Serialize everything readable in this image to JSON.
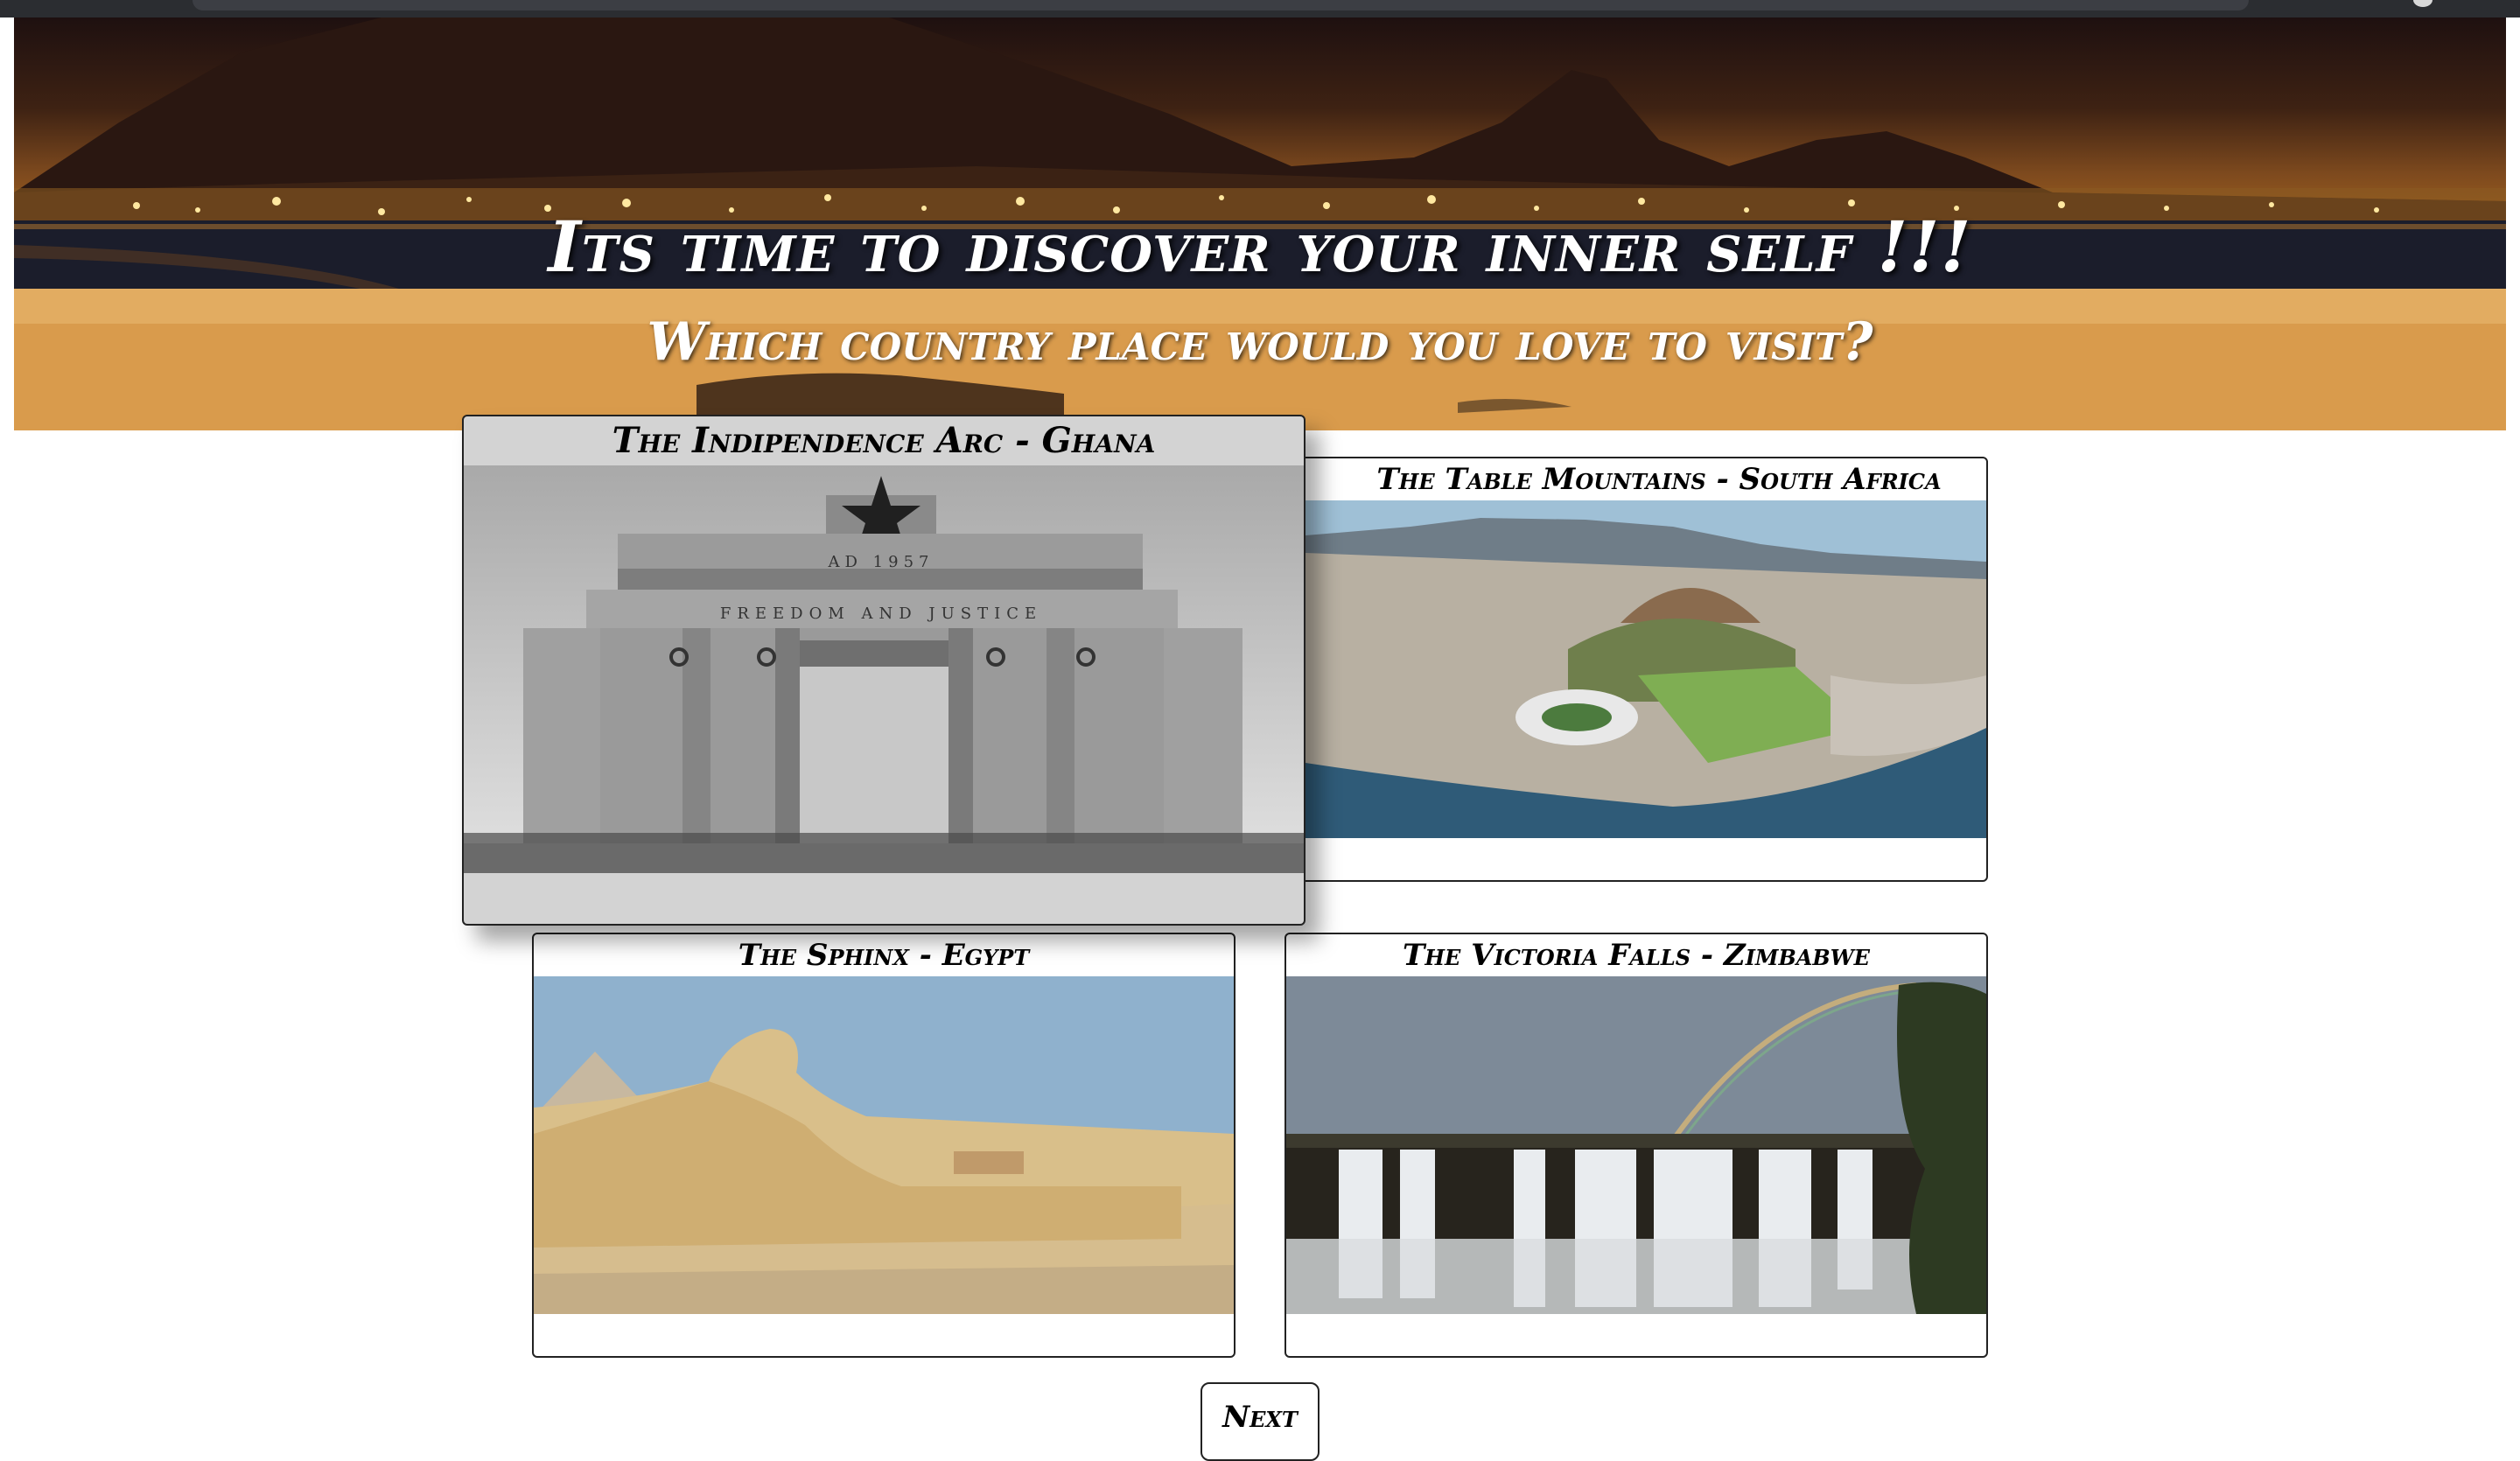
{
  "hero": {
    "title": "Its time to discover your inner self !!!",
    "subtitle": "Which country place would you love to visit?"
  },
  "destinations": [
    {
      "title": "The Indipendence Arc - Ghana",
      "image_icon": "arch-photo",
      "monument_text_1": "AD 1957",
      "monument_text_2": "FREEDOM AND JUSTICE"
    },
    {
      "title": "The Table Mountains - South Africa",
      "image_icon": "city-aerial-photo"
    },
    {
      "title": "The Sphinx - Egypt",
      "image_icon": "sphinx-photo"
    },
    {
      "title": "The Victoria Falls - Zimbabwe",
      "image_icon": "waterfall-photo"
    }
  ],
  "next_button": {
    "label": "Next"
  },
  "colors": {
    "card_border": "#222222",
    "hovered_card_bg": "#d3d3d3",
    "hero_sky_top": "#1e1010",
    "hero_sky_bottom": "#e6b36e"
  }
}
